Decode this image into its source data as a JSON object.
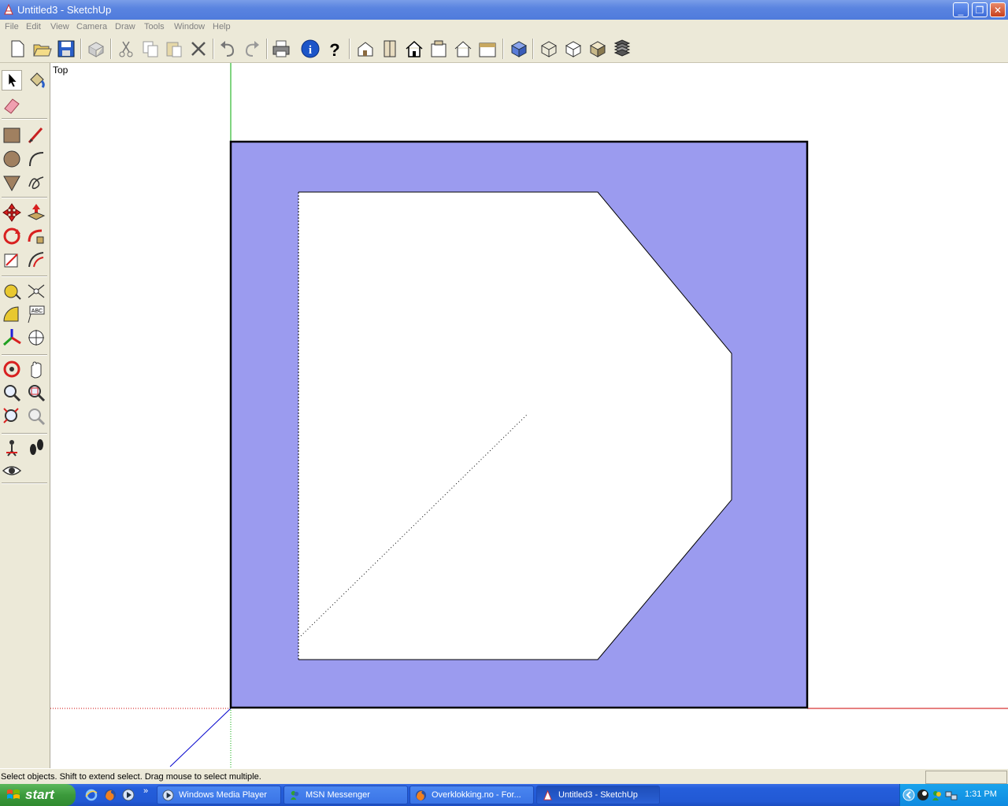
{
  "window": {
    "title": "Untitled3 - SketchUp",
    "controls": {
      "minimize": "_",
      "maximize": "❐",
      "close": "✕"
    }
  },
  "menu": [
    "File",
    "Edit",
    "View",
    "Camera",
    "Draw",
    "Tools",
    "Window",
    "Help"
  ],
  "toolbar": {
    "icons": [
      "new-icon",
      "open-icon",
      "save-icon",
      "make-component-icon",
      "cut-icon",
      "copy-icon",
      "paste-icon",
      "erase-icon",
      "undo-icon",
      "redo-icon",
      "print-icon",
      "model-info-icon",
      "help-icon",
      "iso-view-icon",
      "top-view-icon",
      "front-view-icon",
      "right-view-icon",
      "back-view-icon",
      "left-view-icon",
      "xray-icon",
      "wireframe-icon",
      "hidden-line-icon",
      "shaded-icon",
      "shaded-texture-icon"
    ]
  },
  "palette": {
    "icons": [
      "select-icon",
      "paint-bucket-icon",
      "eraser-icon",
      "rectangle-icon",
      "line-icon",
      "circle-icon",
      "arc-icon",
      "polygon-icon",
      "freehand-icon",
      "move-icon",
      "push-pull-icon",
      "rotate-icon",
      "follow-me-icon",
      "scale-icon",
      "offset-icon",
      "tape-measure-icon",
      "dimension-icon",
      "protractor-icon",
      "text-icon",
      "axes-icon",
      "3d-text-icon",
      "orbit-icon",
      "pan-icon",
      "zoom-icon",
      "zoom-window-icon",
      "zoom-extents-icon",
      "previous-icon",
      "position-camera-icon",
      "walk-icon",
      "look-around-icon"
    ]
  },
  "viewport": {
    "view_label": "Top",
    "face_color": "#9b9bef",
    "axis_colors": {
      "red": "#cc0000",
      "green": "#00aa00",
      "blue": "#0000cc"
    }
  },
  "status": {
    "message": "Select objects. Shift to extend select. Drag mouse to select multiple."
  },
  "taskbar": {
    "start_label": "start",
    "tasks": [
      {
        "label": "Windows Media Player",
        "active": false
      },
      {
        "label": "MSN Messenger",
        "active": false
      },
      {
        "label": "Overklokking.no - For...",
        "active": false
      },
      {
        "label": "Untitled3 - SketchUp",
        "active": true
      }
    ],
    "clock": "1:31 PM",
    "chevron": "»"
  }
}
